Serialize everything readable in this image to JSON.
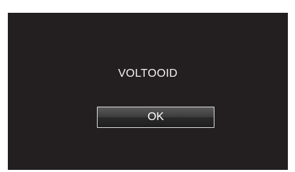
{
  "dialog": {
    "message": "VOLTOOID",
    "ok_label": "OK"
  },
  "colors": {
    "screen_background": "#231f20",
    "text": "#f2f2f2",
    "button_border": "#d9d9d9"
  }
}
